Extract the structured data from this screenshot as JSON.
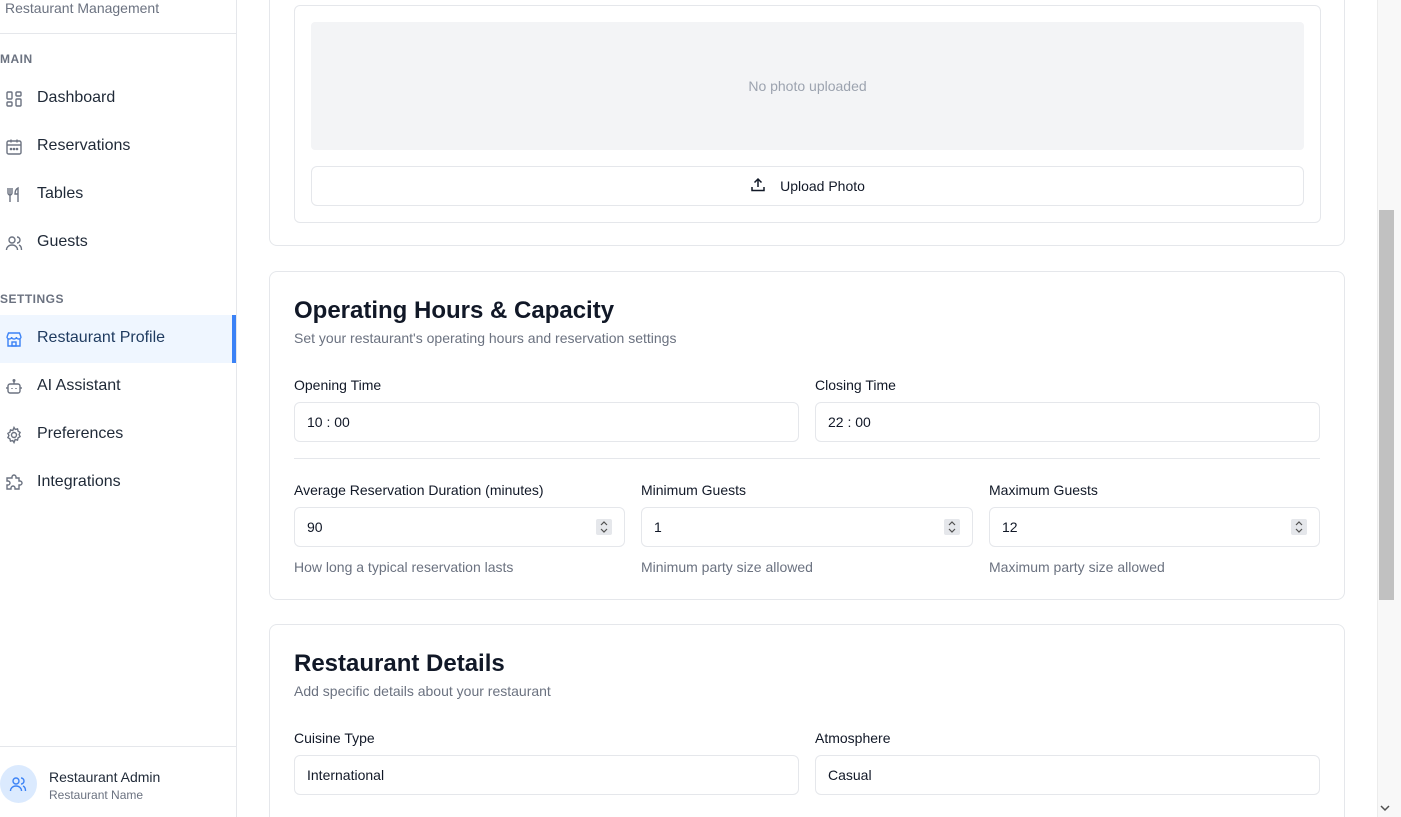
{
  "sidebar": {
    "brand_subtitle": "Restaurant Management",
    "sections": {
      "main_label": "MAIN",
      "settings_label": "SETTINGS"
    },
    "items": [
      {
        "label": "Dashboard",
        "icon": "dashboard-icon"
      },
      {
        "label": "Reservations",
        "icon": "calendar-icon"
      },
      {
        "label": "Tables",
        "icon": "utensils-icon"
      },
      {
        "label": "Guests",
        "icon": "users-icon"
      },
      {
        "label": "Restaurant Profile",
        "icon": "store-icon",
        "active": true
      },
      {
        "label": "AI Assistant",
        "icon": "bot-icon"
      },
      {
        "label": "Preferences",
        "icon": "gear-icon"
      },
      {
        "label": "Integrations",
        "icon": "puzzle-icon"
      }
    ],
    "user": {
      "name": "Restaurant Admin",
      "subtitle": "Restaurant Name"
    }
  },
  "photo": {
    "placeholder": "No photo uploaded",
    "upload_label": "Upload Photo"
  },
  "hours": {
    "title": "Operating Hours & Capacity",
    "description": "Set your restaurant's operating hours and reservation settings",
    "opening_label": "Opening Time",
    "opening_value": "10 : 00",
    "closing_label": "Closing Time",
    "closing_value": "22 : 00",
    "duration_label": "Average Reservation Duration (minutes)",
    "duration_value": "90",
    "duration_hint": "How long a typical reservation lasts",
    "min_label": "Minimum Guests",
    "min_value": "1",
    "min_hint": "Minimum party size allowed",
    "max_label": "Maximum Guests",
    "max_value": "12",
    "max_hint": "Maximum party size allowed"
  },
  "details": {
    "title": "Restaurant Details",
    "description": "Add specific details about your restaurant",
    "cuisine_label": "Cuisine Type",
    "cuisine_value": "International",
    "atmosphere_label": "Atmosphere",
    "atmosphere_value": "Casual"
  },
  "colors": {
    "accent": "#3b82f6",
    "active_bg": "#eff6ff"
  }
}
